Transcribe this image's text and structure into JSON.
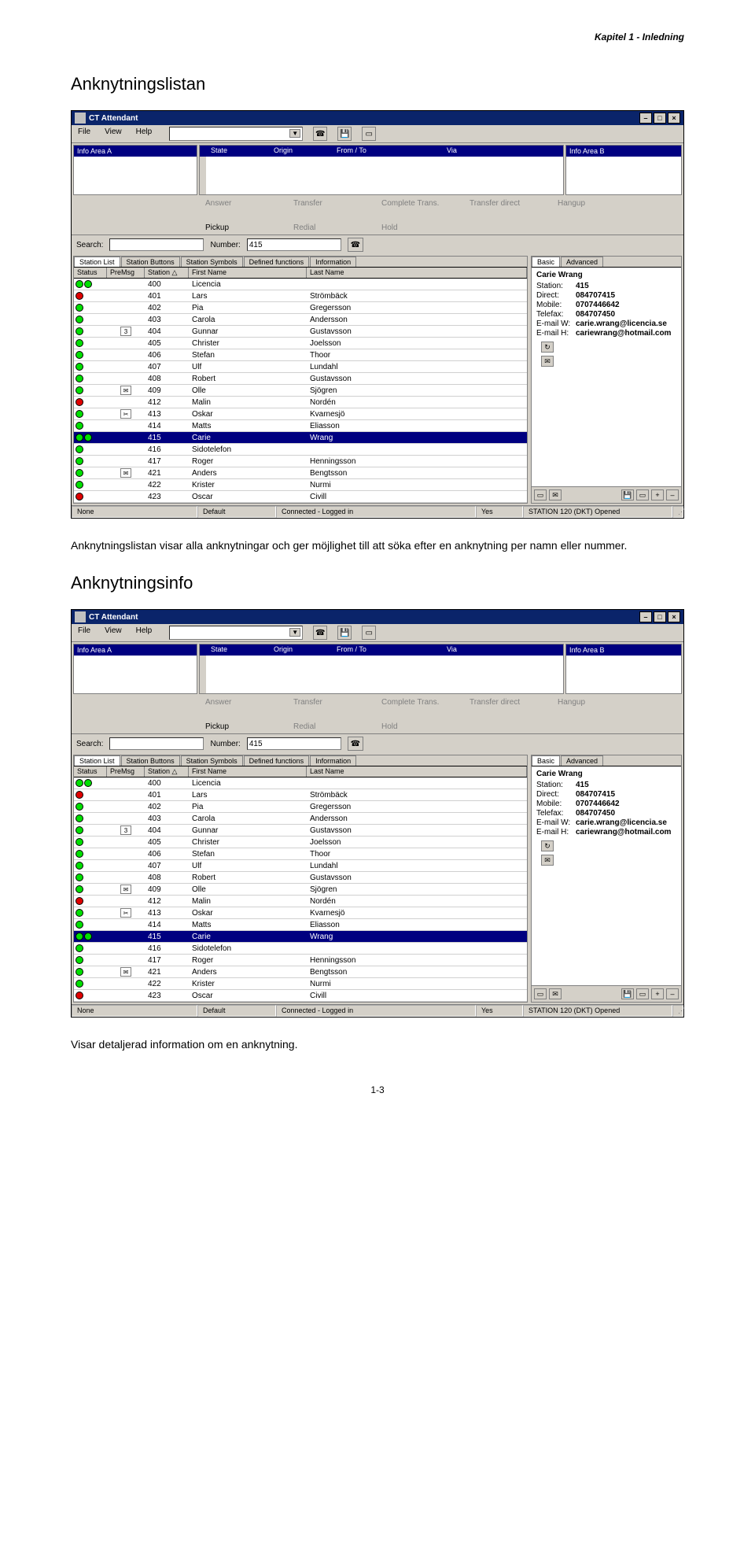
{
  "page": {
    "chapter_header": "Kapitel 1 - Inledning",
    "section1_title": "Anknytningslistan",
    "section1_body": "Anknytningslistan visar alla anknytningar och ger möjlighet till att söka efter en anknytning per namn eller nummer.",
    "section2_title": "Anknytningsinfo",
    "section2_body": "Visar detaljerad information om en anknytning.",
    "page_number": "1-3"
  },
  "app": {
    "title": "CT Attendant",
    "menu": {
      "file": "File",
      "view": "View",
      "help": "Help"
    },
    "info_headers": {
      "area_a": "Info Area A",
      "state": "State",
      "origin": "Origin",
      "from_to": "From / To",
      "via": "Via",
      "area_b": "Info Area B"
    },
    "call_actions": {
      "answer": "Answer",
      "transfer": "Transfer",
      "complete_trans": "Complete Trans.",
      "transfer_direct": "Transfer direct",
      "hangup": "Hangup",
      "pickup": "Pickup",
      "redial": "Redial",
      "hold": "Hold"
    },
    "search": {
      "search_label": "Search:",
      "number_label": "Number:",
      "number_value": "415"
    },
    "tabs_left": {
      "station_list": "Station List",
      "station_buttons": "Station Buttons",
      "station_symbols": "Station Symbols",
      "defined_functions": "Defined functions",
      "information": "Information"
    },
    "tabs_right": {
      "basic": "Basic",
      "advanced": "Advanced"
    },
    "columns": {
      "status": "Status",
      "premsg": "PreMsg",
      "station": "Station △",
      "first_name": "First Name",
      "last_name": "Last Name"
    },
    "rows": [
      {
        "status": [
          "green",
          "green"
        ],
        "premsg": "",
        "station": "400",
        "first": "Licencia",
        "last": ""
      },
      {
        "status": [
          "red"
        ],
        "premsg": "",
        "station": "401",
        "first": "Lars",
        "last": "Strömbäck"
      },
      {
        "status": [
          "green"
        ],
        "premsg": "",
        "station": "402",
        "first": "Pia",
        "last": "Gregersson"
      },
      {
        "status": [
          "green"
        ],
        "premsg": "",
        "station": "403",
        "first": "Carola",
        "last": "Andersson"
      },
      {
        "status": [
          "green"
        ],
        "premsg": "3",
        "station": "404",
        "first": "Gunnar",
        "last": "Gustavsson"
      },
      {
        "status": [
          "green"
        ],
        "premsg": "",
        "station": "405",
        "first": "Christer",
        "last": "Joelsson"
      },
      {
        "status": [
          "green"
        ],
        "premsg": "",
        "station": "406",
        "first": "Stefan",
        "last": "Thoor"
      },
      {
        "status": [
          "green"
        ],
        "premsg": "",
        "station": "407",
        "first": "Ulf",
        "last": "Lundahl"
      },
      {
        "status": [
          "green"
        ],
        "premsg": "",
        "station": "408",
        "first": "Robert",
        "last": "Gustavsson"
      },
      {
        "status": [
          "green"
        ],
        "premsg": "✉",
        "station": "409",
        "first": "Olle",
        "last": "Sjögren"
      },
      {
        "status": [
          "red"
        ],
        "premsg": "",
        "station": "412",
        "first": "Malin",
        "last": "Nordén"
      },
      {
        "status": [
          "green"
        ],
        "premsg": "✂",
        "station": "413",
        "first": "Oskar",
        "last": "Kvarnesjö"
      },
      {
        "status": [
          "green"
        ],
        "premsg": "",
        "station": "414",
        "first": "Matts",
        "last": "Eliasson"
      },
      {
        "status": [
          "green",
          "green"
        ],
        "premsg": "",
        "station": "415",
        "first": "Carie",
        "last": "Wrang",
        "selected": true
      },
      {
        "status": [
          "green"
        ],
        "premsg": "",
        "station": "416",
        "first": "Sidotelefon",
        "last": ""
      },
      {
        "status": [
          "green"
        ],
        "premsg": "",
        "station": "417",
        "first": "Roger",
        "last": "Henningsson"
      },
      {
        "status": [
          "green"
        ],
        "premsg": "✉",
        "station": "421",
        "first": "Anders",
        "last": "Bengtsson"
      },
      {
        "status": [
          "green"
        ],
        "premsg": "",
        "station": "422",
        "first": "Krister",
        "last": "Nurmi"
      },
      {
        "status": [
          "red"
        ],
        "premsg": "",
        "station": "423",
        "first": "Oscar",
        "last": "Civill"
      }
    ],
    "detail": {
      "name": "Carie Wrang",
      "fields": {
        "station_l": "Station:",
        "station_v": "415",
        "direct_l": "Direct:",
        "direct_v": "084707415",
        "mobile_l": "Mobile:",
        "mobile_v": "0707446642",
        "telefax_l": "Telefax:",
        "telefax_v": "084707450",
        "emailw_l": "E-mail W:",
        "emailw_v": "carie.wrang@licencia.se",
        "emailh_l": "E-mail H:",
        "emailh_v": "cariewrang@hotmail.com"
      }
    },
    "statusbar": {
      "c1": "None",
      "c2": "Default",
      "c3": "Connected - Logged in",
      "c4": "Yes",
      "c5": "STATION 120 (DKT) Opened"
    }
  }
}
